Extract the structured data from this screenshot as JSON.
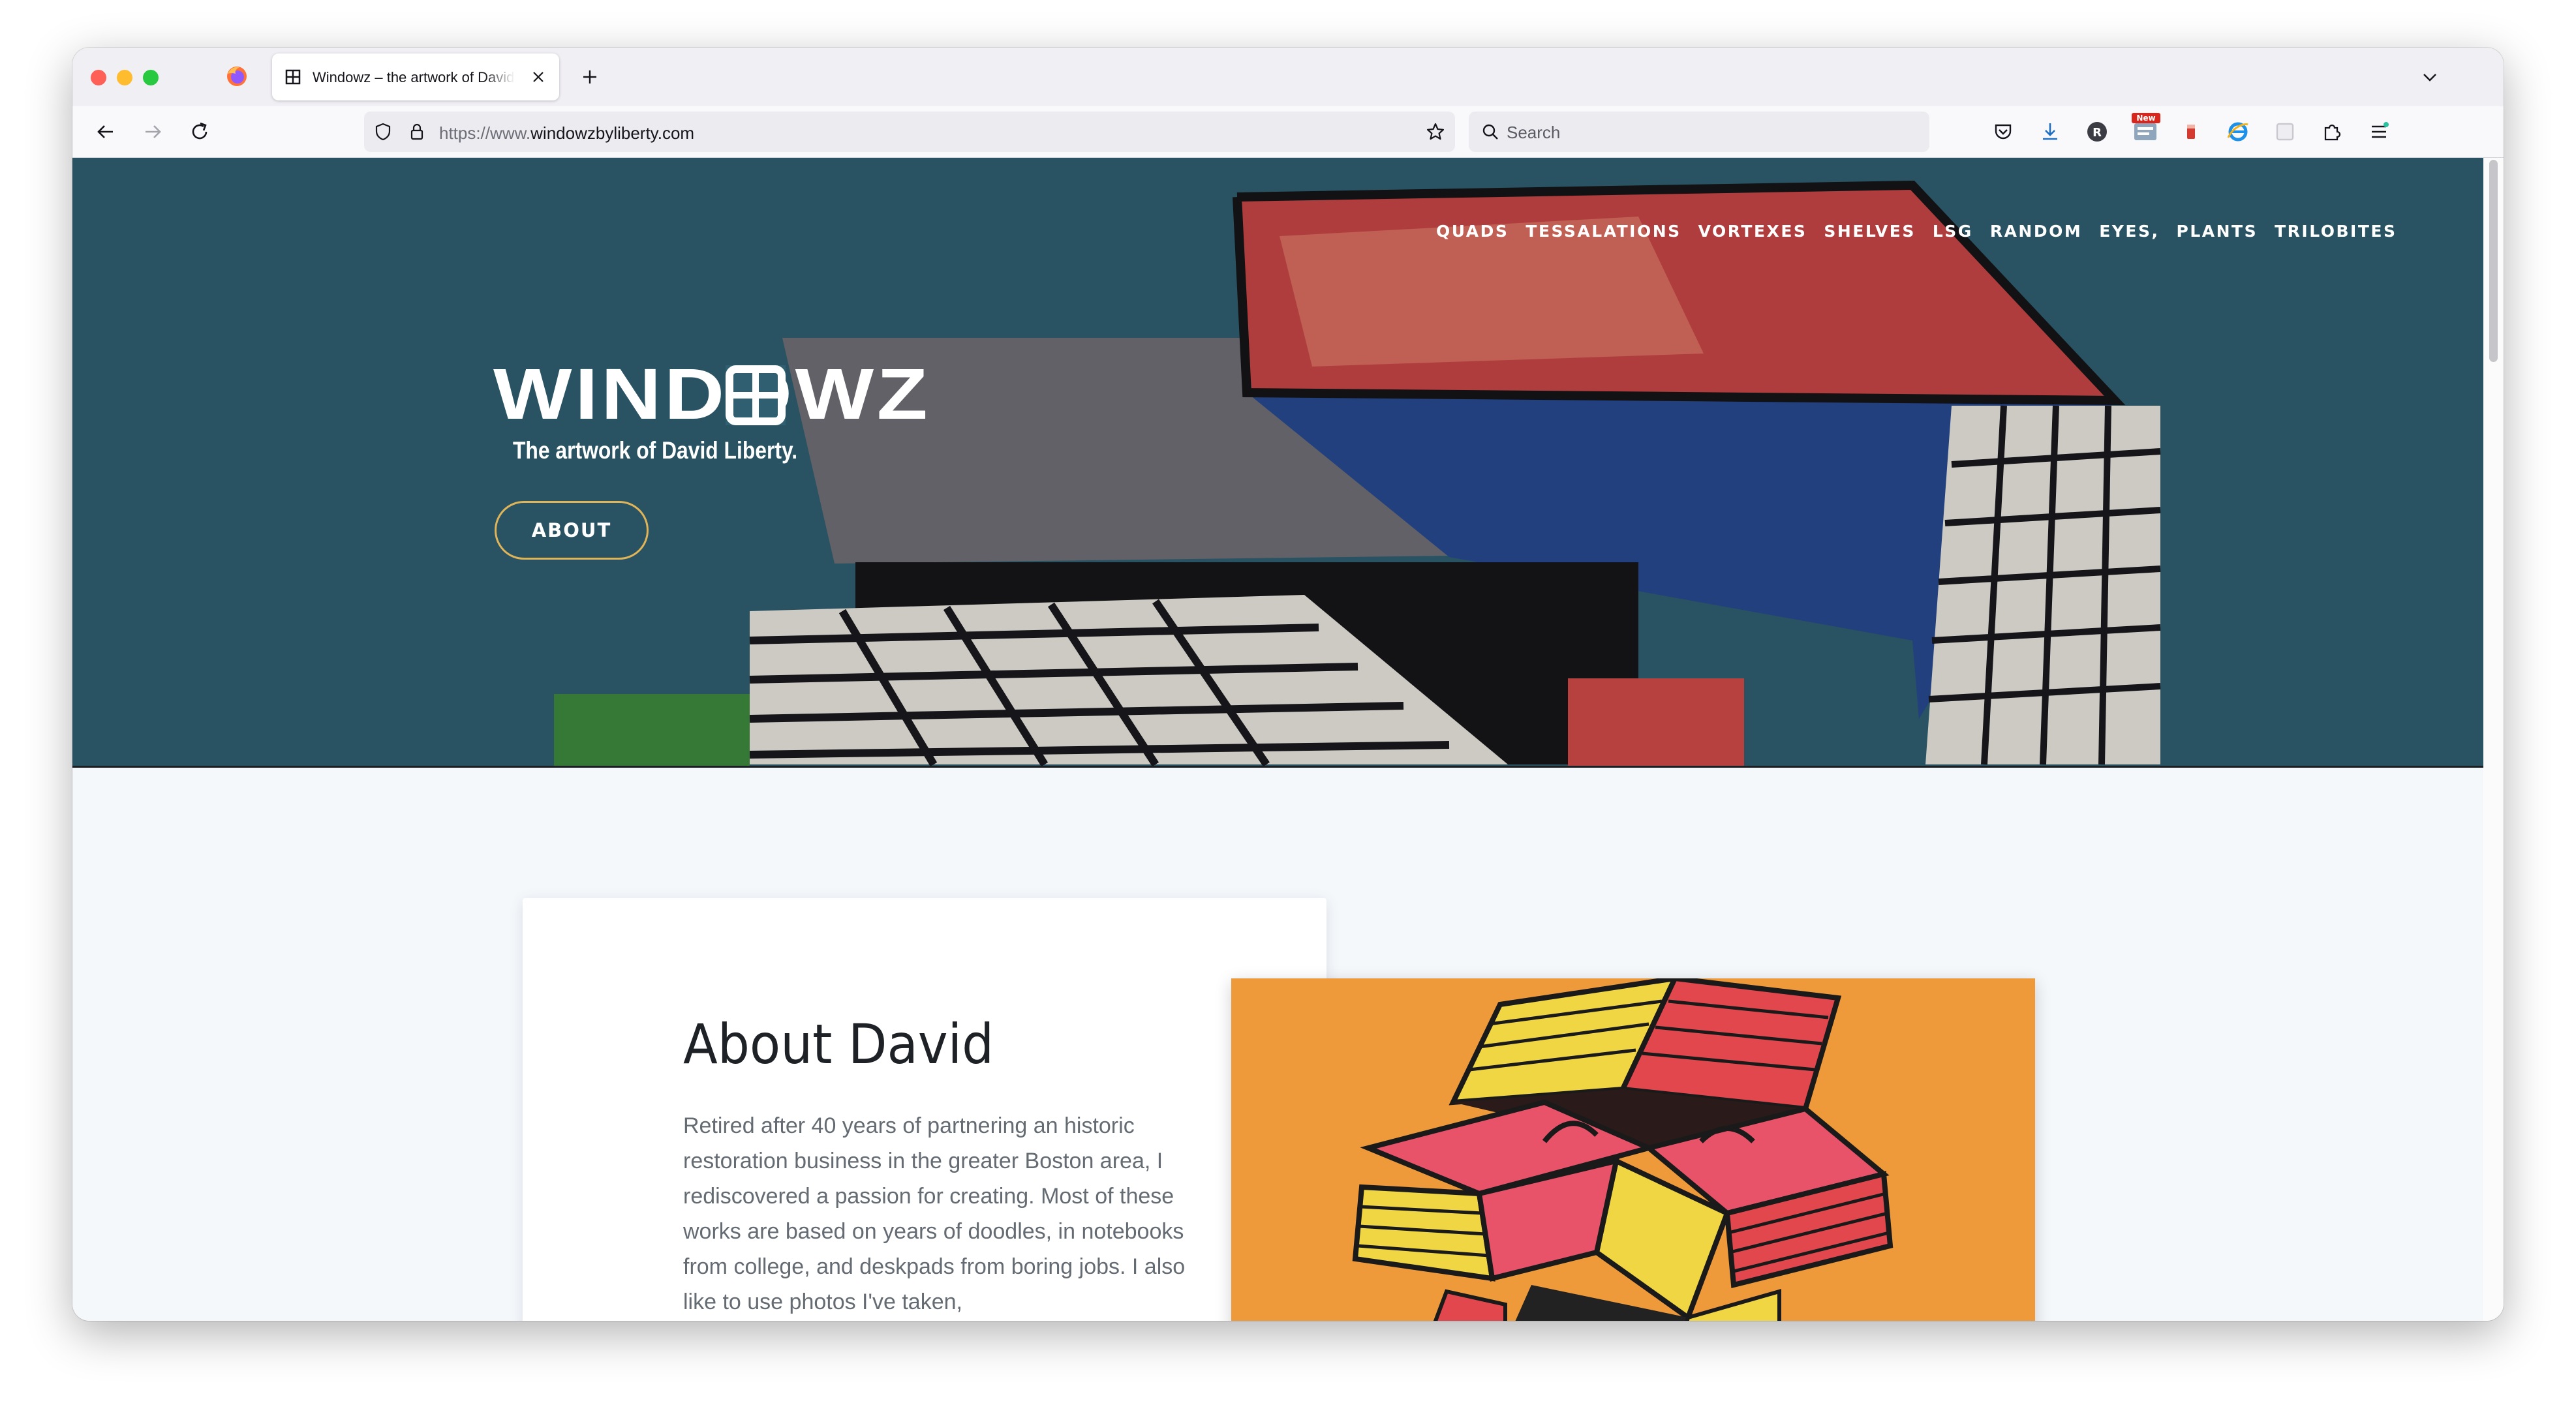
{
  "browser": {
    "tab": {
      "title": "Windowz – the artwork of David Liberty"
    },
    "url": {
      "scheme": "https://www.",
      "host": "windowzbyliberty.com"
    },
    "search": {
      "placeholder": "Search"
    },
    "toolbar_badge": "New",
    "icons": [
      "firefox-logo-icon",
      "close-icon",
      "plus-icon",
      "chevron-down-icon",
      "back-arrow-icon",
      "forward-arrow-icon",
      "reload-icon",
      "shield-icon",
      "lock-icon",
      "star-icon",
      "search-icon",
      "pocket-icon",
      "download-icon",
      "account-icon",
      "extension-icon",
      "puzzle-icon",
      "menu-icon"
    ]
  },
  "site": {
    "nav": [
      "QUADS",
      "TESSALATIONS",
      "VORTEXES",
      "SHELVES",
      "LSG",
      "RANDOM",
      "EYES,",
      "PLANTS",
      "TRILOBITES"
    ],
    "logo": "WINDOWZ",
    "tagline": "The artwork of David Liberty.",
    "about_button": "ABOUT",
    "about": {
      "heading": "About David",
      "body": "Retired after 40 years of partnering an historic restoration business in the greater Boston area, I rediscovered a passion for creating. Most of these works are based on years of doodles, in notebooks from college, and deskpads from boring jobs. I also like to use photos I've taken,"
    }
  },
  "colors": {
    "hero_bg": "#2f5f70",
    "button_border": "#e0b559",
    "page_bg": "#f5f8fb",
    "art_orange": "#ee9a3a"
  }
}
